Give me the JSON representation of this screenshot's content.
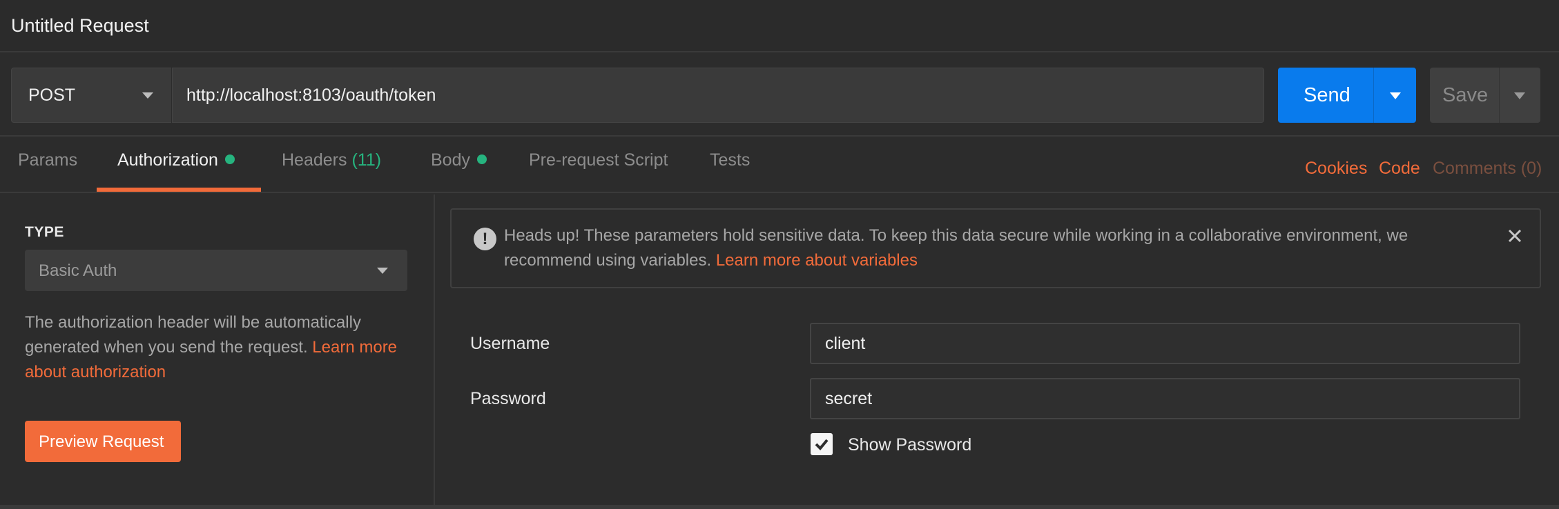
{
  "request": {
    "title": "Untitled Request",
    "method": "POST",
    "url": "http://localhost:8103/oauth/token",
    "send_label": "Send",
    "save_label": "Save"
  },
  "tabs": [
    {
      "label": "Params",
      "count": "",
      "dot": false,
      "active": false
    },
    {
      "label": "Authorization",
      "count": "",
      "dot": true,
      "active": true
    },
    {
      "label": "Headers",
      "count": "(11)",
      "dot": false,
      "active": false
    },
    {
      "label": "Body",
      "count": "",
      "dot": true,
      "active": false
    },
    {
      "label": "Pre-request Script",
      "count": "",
      "dot": false,
      "active": false
    },
    {
      "label": "Tests",
      "count": "",
      "dot": false,
      "active": false
    }
  ],
  "right_links": {
    "cookies": "Cookies",
    "code": "Code",
    "comments": "Comments (0)"
  },
  "auth": {
    "type_heading": "TYPE",
    "type_value": "Basic Auth",
    "help_text": "The authorization header will be automatically generated when you send the request. ",
    "help_link": "Learn more about authorization",
    "preview_label": "Preview Request"
  },
  "alert": {
    "text": "Heads up! These parameters hold sensitive data. To keep this data secure while working in a collaborative environment, we recommend using variables. ",
    "link": "Learn more about variables"
  },
  "fields": {
    "username_label": "Username",
    "username_value": "client",
    "password_label": "Password",
    "password_value": "secret",
    "show_password_label": "Show Password",
    "show_password_checked": true
  },
  "colors": {
    "accent_orange": "#f26b3a",
    "send_blue": "#097bed",
    "status_green": "#26b47f",
    "background": "#2c2c2c"
  },
  "icons": {
    "alert": "exclamation-circle-icon",
    "close": "close-icon",
    "dropdown": "chevron-down-icon",
    "check": "checkmark-icon"
  }
}
